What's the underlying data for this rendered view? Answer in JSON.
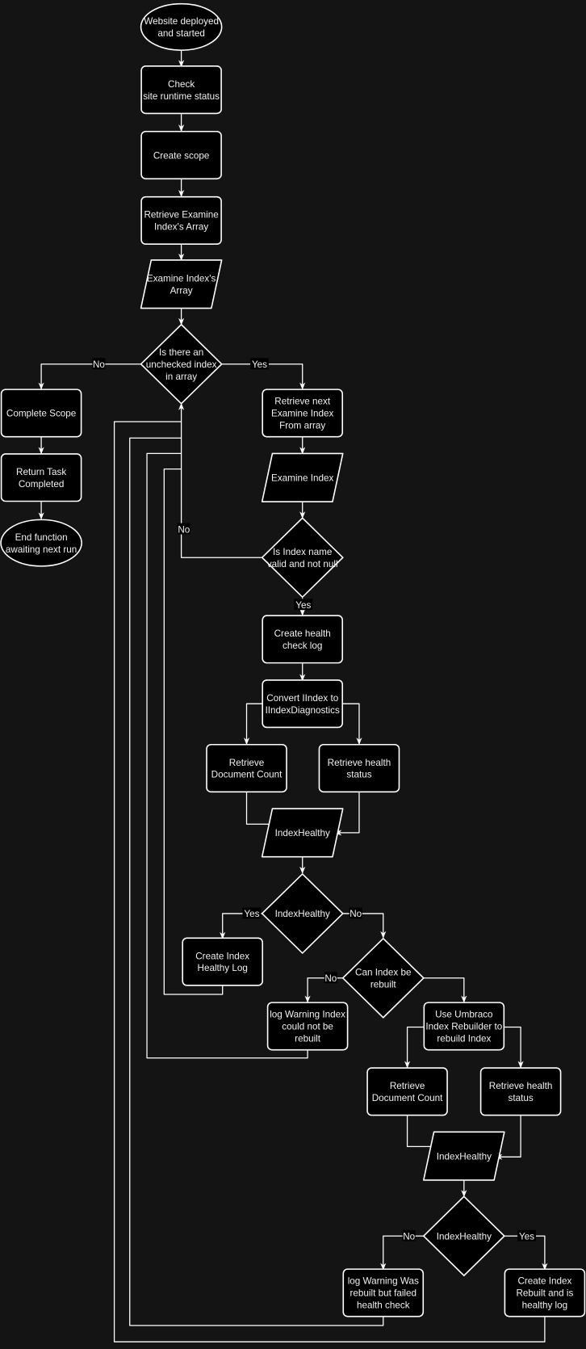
{
  "colors": {
    "background": "#141414",
    "shape_fill": "#000000",
    "stroke": "#ffffff",
    "text": "#f0f0f0"
  },
  "nodes": {
    "start": [
      "Website deployed",
      "and started"
    ],
    "check": [
      "Check",
      "site runtime status"
    ],
    "scope": [
      "Create scope"
    ],
    "retrieve_array": [
      "Retrieve Examine",
      "Index's Array"
    ],
    "array_io": [
      "Examine Index's",
      "Array"
    ],
    "d1": [
      "Is there an",
      "unchecked index",
      "in array"
    ],
    "complete": [
      "Complete Scope"
    ],
    "return": [
      "Return Task",
      "Completed"
    ],
    "end": [
      "End function",
      "awaiting next run"
    ],
    "retrieve_next": [
      "Retrieve next",
      "Examine Index",
      "From array"
    ],
    "index_io": [
      "Examine Index"
    ],
    "d2": [
      "Is Index name",
      "valid and not null"
    ],
    "health_log": [
      "Create health",
      "check log"
    ],
    "convert": [
      "Convert IIndex to",
      "IIndexDiagnostics"
    ],
    "doc1": [
      "Retrieve",
      "Document Count"
    ],
    "stat1": [
      "Retrieve health",
      "status"
    ],
    "hh1": [
      "IndexHealthy"
    ],
    "d3": [
      "IndexHealthy"
    ],
    "healthy_log": [
      "Create Index",
      "Healthy Log"
    ],
    "d4": [
      "Can Index be",
      "rebuilt"
    ],
    "warn1": [
      "log Warning Index",
      "could not be",
      "rebuilt"
    ],
    "rebuild": [
      "Use Umbraco",
      "Index Rebuilder to",
      "rebuild Index"
    ],
    "doc2": [
      "Retrieve",
      "Document Count"
    ],
    "stat2": [
      "Retrieve health",
      "status"
    ],
    "hh2": [
      "IndexHealthy"
    ],
    "d5": [
      "IndexHealthy"
    ],
    "warn2": [
      "log Warning Was",
      "rebuilt but failed",
      "health check"
    ],
    "rebuilt_log": [
      "Create Index",
      "Rebuilt and is",
      "healthy log"
    ]
  },
  "edge_labels": {
    "d1_no": "No",
    "d1_yes": "Yes",
    "d2_no": "No",
    "d2_yes": "Yes",
    "d3_yes": "Yes",
    "d3_no": "No",
    "d4_no": "No",
    "d5_no": "No",
    "d5_yes": "Yes"
  }
}
